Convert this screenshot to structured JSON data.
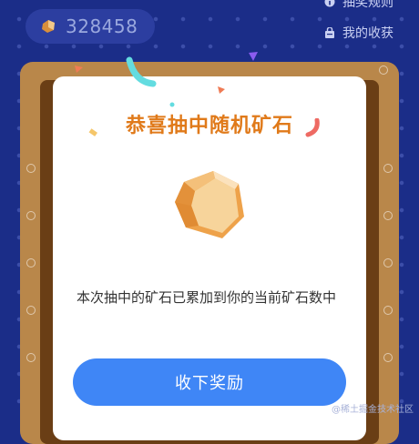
{
  "header": {
    "ore_count": "328458",
    "rules_label": "抽奖规则",
    "my_prizes_label": "我的收获"
  },
  "modal": {
    "title": "恭喜抽中随机矿石",
    "message": "本次抽中的矿石已累加到你的当前矿石数中",
    "claim_button_label": "收下奖励"
  },
  "watermark": "@稀土掘金技术社区",
  "colors": {
    "background": "#1b2d88",
    "title": "#e07a1a",
    "button": "#3f86f6",
    "frame": "#b9874a"
  },
  "icons": {
    "ore_mini": "ore-icon",
    "rules": "info-icon",
    "my_prizes": "bag-icon",
    "ore_large": "ore-icon"
  }
}
